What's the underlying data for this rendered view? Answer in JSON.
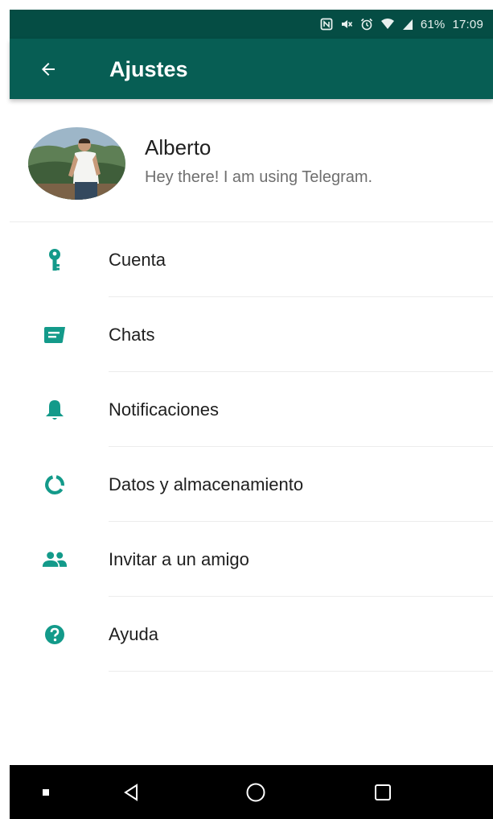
{
  "status_bar": {
    "battery": "61%",
    "time": "17:09",
    "icons": [
      "nfc-icon",
      "mute-icon",
      "alarm-icon",
      "wifi-icon",
      "signal-icon"
    ]
  },
  "header": {
    "title": "Ajustes",
    "back_icon": "arrow-left-icon"
  },
  "profile": {
    "name": "Alberto",
    "status": "Hey there! I am using Telegram."
  },
  "menu": {
    "items": [
      {
        "label": "Cuenta",
        "icon": "key-icon"
      },
      {
        "label": "Chats",
        "icon": "chat-icon"
      },
      {
        "label": "Notificaciones",
        "icon": "bell-icon"
      },
      {
        "label": "Datos y almacenamiento",
        "icon": "data-usage-icon"
      },
      {
        "label": "Invitar a un amigo",
        "icon": "people-icon"
      },
      {
        "label": "Ayuda",
        "icon": "help-icon"
      }
    ]
  },
  "colors": {
    "app_bar": "#075e54",
    "status_bar": "#054d44",
    "accent": "#139a8a"
  }
}
